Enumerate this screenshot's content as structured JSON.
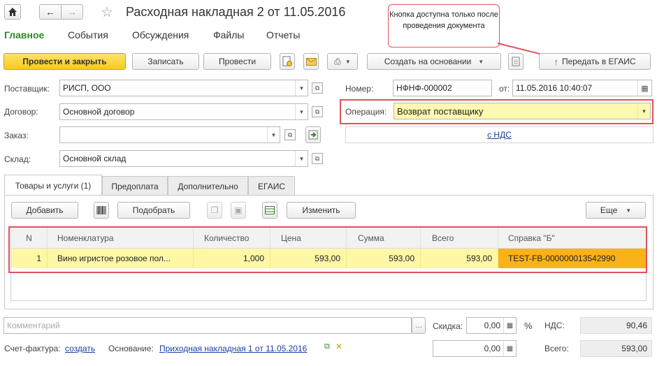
{
  "window": {
    "title": "Расходная накладная 2 от 11.05.2016"
  },
  "nav_tabs": [
    "Главное",
    "События",
    "Обсуждения",
    "Файлы",
    "Отчеты"
  ],
  "callout": {
    "text": "Кнопка доступна только после проведения документа"
  },
  "toolbar": {
    "post_close": "Провести и закрыть",
    "save": "Записать",
    "post": "Провести",
    "create_based": "Создать на основании",
    "send_egais": "Передать в ЕГАИС"
  },
  "form": {
    "supplier_label": "Поставщик:",
    "supplier_value": "РИСП, ООО",
    "contract_label": "Договор:",
    "contract_value": "Основной договор",
    "order_label": "Заказ:",
    "order_value": "",
    "warehouse_label": "Склад:",
    "warehouse_value": "Основной склад",
    "number_label": "Номер:",
    "number_value": "НФНФ-000002",
    "date_label": "от:",
    "date_value": "11.05.2016 10:40:07",
    "operation_label": "Операция:",
    "operation_value": "Возврат поставщику",
    "vat_link": "с НДС"
  },
  "doc_tabs": [
    "Товары и услуги (1)",
    "Предоплата",
    "Дополнительно",
    "ЕГАИС"
  ],
  "table_toolbar": {
    "add": "Добавить",
    "pick": "Подобрать",
    "edit": "Изменить",
    "more": "Еще"
  },
  "table": {
    "headers": [
      "N",
      "Номенклатура",
      "Количество",
      "Цена",
      "Сумма",
      "Всего",
      "Справка \"Б\""
    ],
    "rows": [
      [
        "1",
        "Вино игристое розовое пол...",
        "1,000",
        "593,00",
        "593,00",
        "593,00",
        "TEST-FB-000000013542990"
      ]
    ]
  },
  "footer": {
    "comment_placeholder": "Комментарий",
    "discount_label": "Скидка:",
    "discount_value": "0,00",
    "percent": "%",
    "vat_label": "НДС:",
    "vat_value": "90,46",
    "total_label": "Всего:",
    "total_value": "593,00",
    "amount_value": "0,00",
    "invoice_label": "Счет-фактура:",
    "invoice_link": "создать",
    "basis_label": "Основание:",
    "basis_link": "Приходная накладная 1 от 11.05.2016"
  },
  "colors": {
    "accent_green": "#2a8a1f",
    "highlight_red": "#e0525a",
    "main_button": "#f7c821",
    "row_yellow": "#fdf7a6",
    "cell_orange": "#f9b21a"
  }
}
